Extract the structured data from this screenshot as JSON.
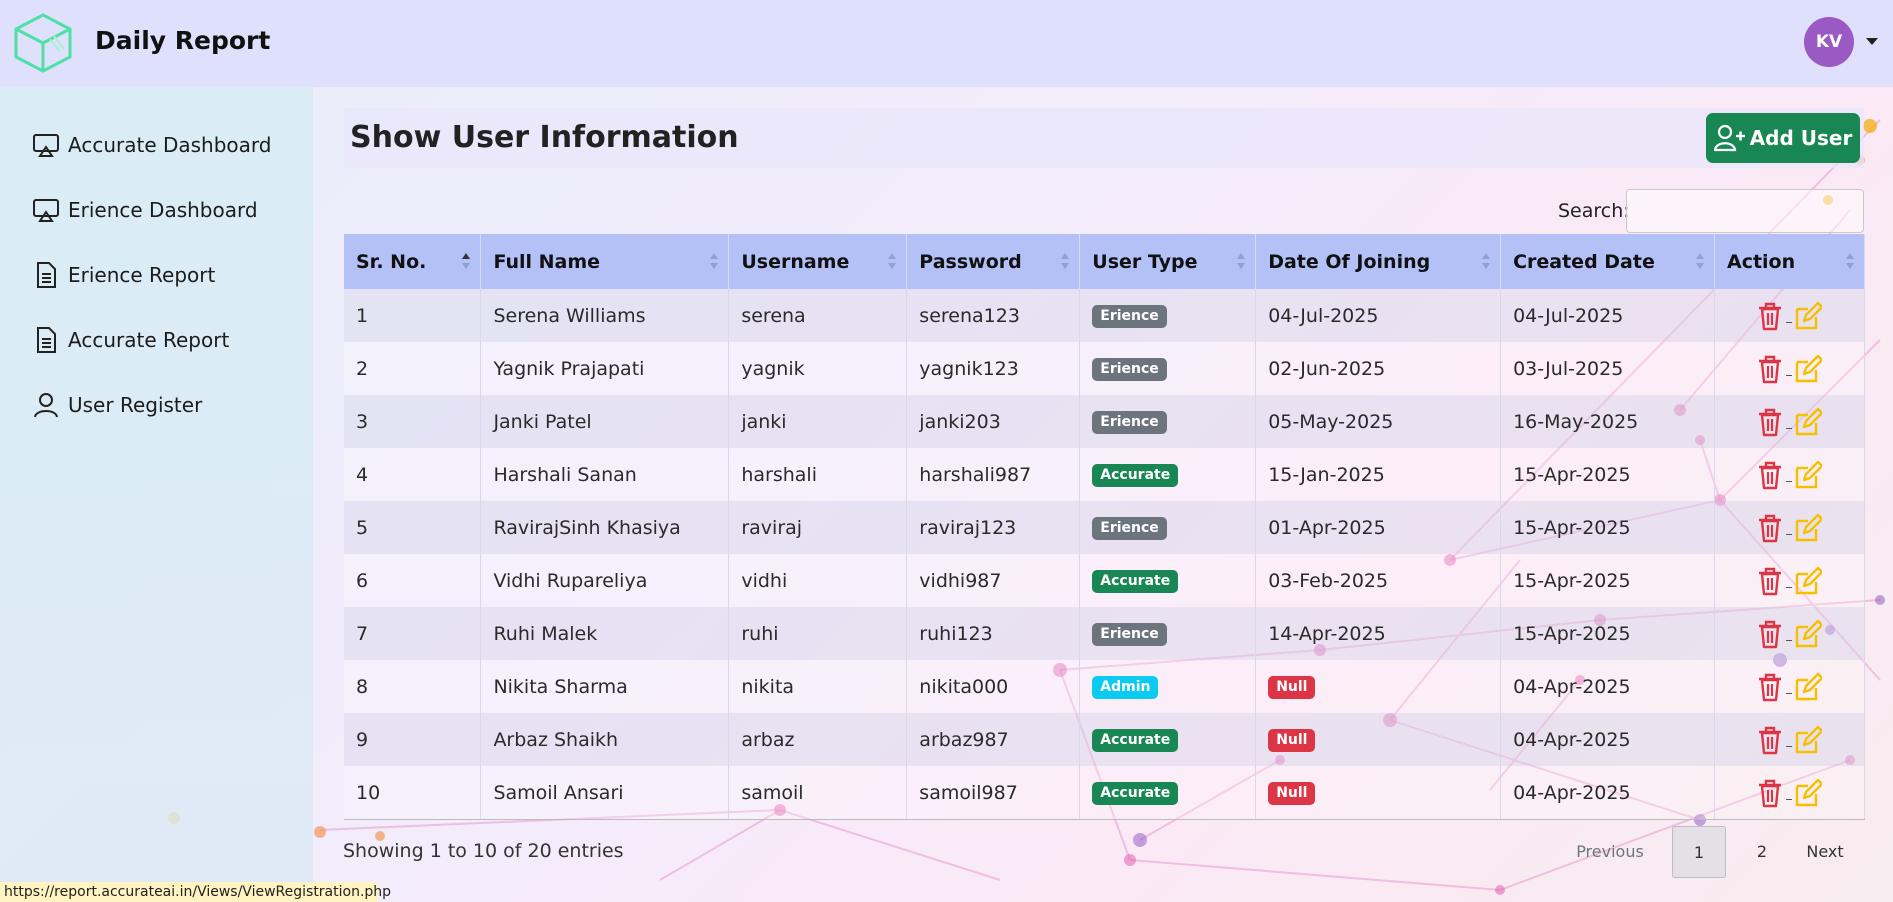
{
  "header": {
    "brand": "Daily Report",
    "avatar_initials": "KV"
  },
  "sidebar": {
    "items": [
      {
        "label": "Accurate Dashboard",
        "icon": "airplay-icon"
      },
      {
        "label": "Erience Dashboard",
        "icon": "airplay-icon"
      },
      {
        "label": "Erience Report",
        "icon": "document-icon"
      },
      {
        "label": "Accurate Report",
        "icon": "document-icon"
      },
      {
        "label": "User Register",
        "icon": "user-icon"
      }
    ]
  },
  "main": {
    "title": "Show User Information",
    "add_button": "Add User",
    "search_label": "Search:",
    "search_value": "",
    "columns": [
      "Sr. No.",
      "Full Name",
      "Username",
      "Password",
      "User Type",
      "Date Of Joining",
      "Created Date",
      "Action"
    ],
    "rows": [
      {
        "sr": "1",
        "name": "Serena Williams",
        "username": "serena",
        "password": "serena123",
        "type": "Erience",
        "joining": "04-Jul-2025",
        "created": "04-Jul-2025"
      },
      {
        "sr": "2",
        "name": "Yagnik Prajapati",
        "username": "yagnik",
        "password": "yagnik123",
        "type": "Erience",
        "joining": "02-Jun-2025",
        "created": "03-Jul-2025"
      },
      {
        "sr": "3",
        "name": "Janki Patel",
        "username": "janki",
        "password": "janki203",
        "type": "Erience",
        "joining": "05-May-2025",
        "created": "16-May-2025"
      },
      {
        "sr": "4",
        "name": "Harshali Sanan",
        "username": "harshali",
        "password": "harshali987",
        "type": "Accurate",
        "joining": "15-Jan-2025",
        "created": "15-Apr-2025"
      },
      {
        "sr": "5",
        "name": "RavirajSinh Khasiya",
        "username": "raviraj",
        "password": "raviraj123",
        "type": "Erience",
        "joining": "01-Apr-2025",
        "created": "15-Apr-2025"
      },
      {
        "sr": "6",
        "name": "Vidhi Rupareliya",
        "username": "vidhi",
        "password": "vidhi987",
        "type": "Accurate",
        "joining": "03-Feb-2025",
        "created": "15-Apr-2025"
      },
      {
        "sr": "7",
        "name": "Ruhi Malek",
        "username": "ruhi",
        "password": "ruhi123",
        "type": "Erience",
        "joining": "14-Apr-2025",
        "created": "15-Apr-2025"
      },
      {
        "sr": "8",
        "name": "Nikita Sharma",
        "username": "nikita",
        "password": "nikita000",
        "type": "Admin",
        "joining": "Null",
        "created": "04-Apr-2025"
      },
      {
        "sr": "9",
        "name": "Arbaz Shaikh",
        "username": "arbaz",
        "password": "arbaz987",
        "type": "Accurate",
        "joining": "Null",
        "created": "04-Apr-2025"
      },
      {
        "sr": "10",
        "name": "Samoil Ansari",
        "username": "samoil",
        "password": "samoil987",
        "type": "Accurate",
        "joining": "Null",
        "created": "04-Apr-2025"
      }
    ],
    "badge_colors": {
      "Erience": "#6c757d",
      "Accurate": "#198754",
      "Admin": "#0dcaf0",
      "Null": "#dc3545"
    },
    "info": "Showing 1 to 10 of 20 entries",
    "pagination": {
      "previous": "Previous",
      "pages": [
        "1",
        "2"
      ],
      "next": "Next"
    }
  },
  "statusbar": {
    "url": "https://report.accurateai.in/Views/ViewRegistration.php"
  }
}
